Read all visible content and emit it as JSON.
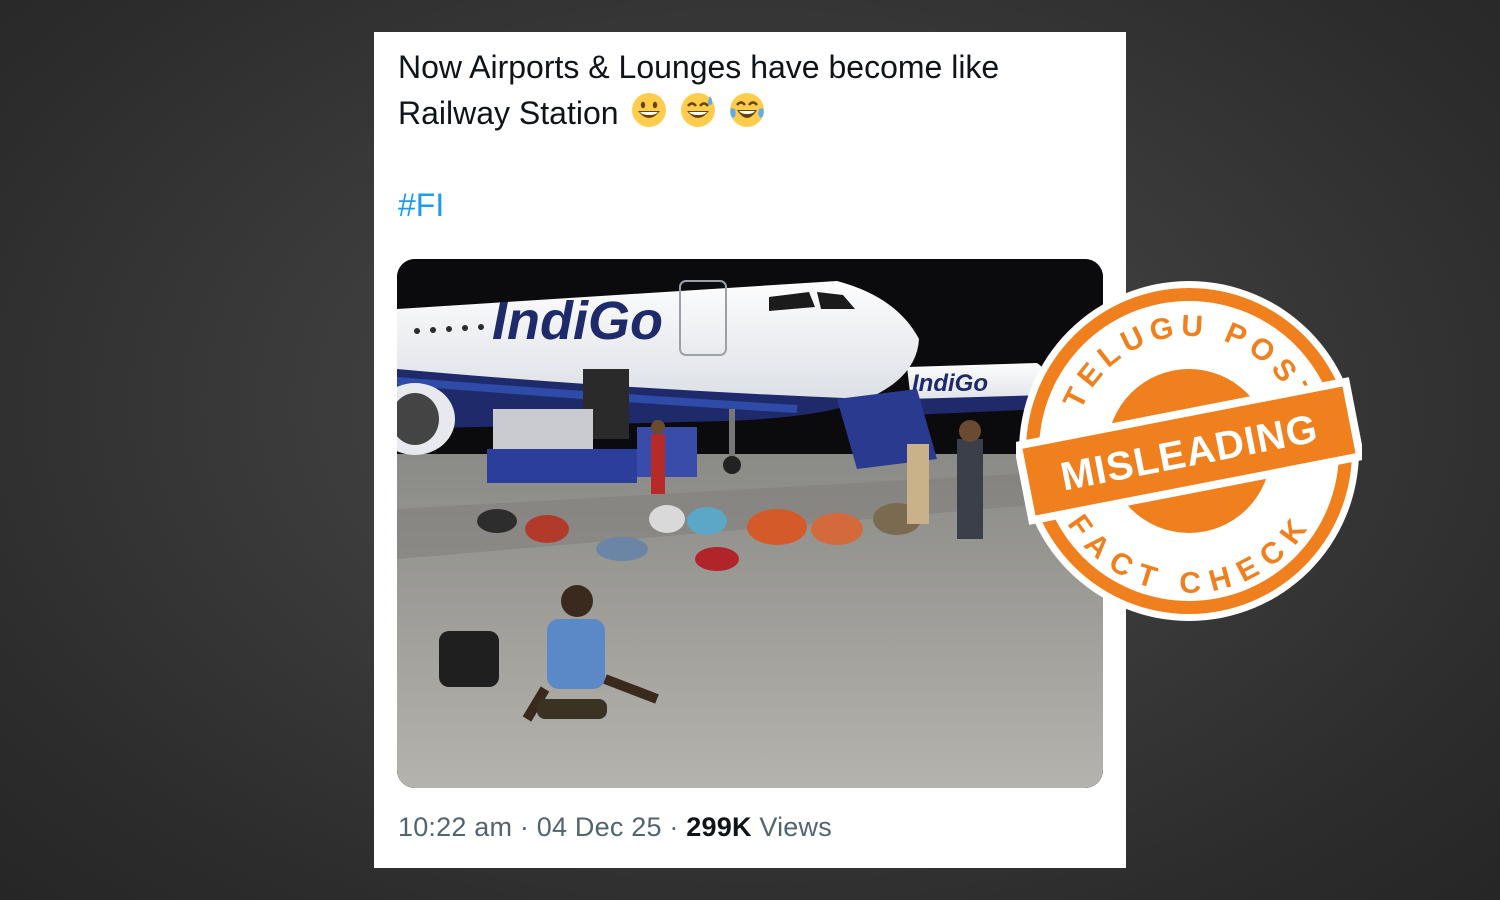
{
  "tweet": {
    "text_line1": "Now Airports & Lounges have become like",
    "text_line2": "Railway Station",
    "emojis": [
      "grinning-face",
      "grinning-face-with-sweat",
      "face-with-tears-of-joy"
    ],
    "hashtag": "#FI",
    "time": "10:22 am",
    "sep1": "·",
    "date": "04 Dec 25",
    "sep2": "·",
    "views_count": "299K",
    "views_label": "Views"
  },
  "photo": {
    "aircraft_livery": "IndiGo",
    "aircraft_livery_2": "IndiGo"
  },
  "stamp": {
    "brand": "TELUGU POST",
    "verdict": "MISLEADING",
    "label": "FACT CHECK",
    "color": "#f07f1e"
  }
}
